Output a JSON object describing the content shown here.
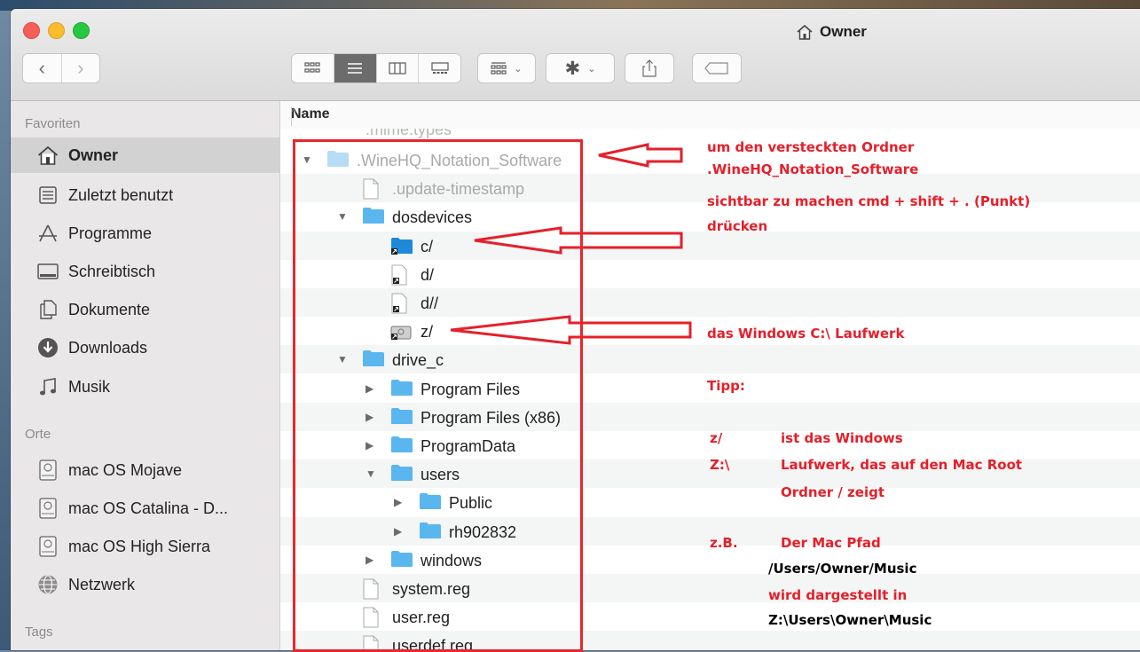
{
  "window": {
    "title": "Owner"
  },
  "toolbar": {
    "back_label": "‹",
    "forward_label": "›",
    "views": [
      "icon-view",
      "list-view",
      "column-view",
      "gallery-view"
    ],
    "group_by": "group-by",
    "action": "gear",
    "share": "share",
    "tags": "tag"
  },
  "sidebar": {
    "favorites_header": "Favoriten",
    "favorites": [
      {
        "label": "Owner",
        "icon": "home-icon",
        "selected": true
      },
      {
        "label": "Zuletzt benutzt",
        "icon": "recents-icon"
      },
      {
        "label": "Programme",
        "icon": "applications-icon"
      },
      {
        "label": "Schreibtisch",
        "icon": "desktop-icon"
      },
      {
        "label": "Dokumente",
        "icon": "documents-icon"
      },
      {
        "label": "Downloads",
        "icon": "downloads-icon"
      },
      {
        "label": "Musik",
        "icon": "music-icon"
      }
    ],
    "locations_header": "Orte",
    "locations": [
      {
        "label": "mac OS Mojave",
        "icon": "disk-icon"
      },
      {
        "label": "mac OS Catalina - D...",
        "icon": "disk-icon"
      },
      {
        "label": "mac OS High Sierra",
        "icon": "disk-icon"
      },
      {
        "label": "Netzwerk",
        "icon": "network-icon"
      }
    ],
    "tags_header": "Tags"
  },
  "list": {
    "column_name": "Name",
    "partial_item": ".mime.types",
    "rows": [
      {
        "name": ".WineHQ_Notation_Software",
        "kind": "folder",
        "depth": 0,
        "expanded": true,
        "hidden": true
      },
      {
        "name": ".update-timestamp",
        "kind": "file",
        "depth": 1,
        "hidden": true
      },
      {
        "name": "dosdevices",
        "kind": "folder",
        "depth": 1,
        "expanded": true
      },
      {
        "name": "c/",
        "kind": "alias-folder",
        "depth": 2
      },
      {
        "name": "d/",
        "kind": "alias",
        "depth": 2
      },
      {
        "name": "d//",
        "kind": "alias",
        "depth": 2
      },
      {
        "name": "z/",
        "kind": "alias-disk",
        "depth": 2
      },
      {
        "name": "drive_c",
        "kind": "folder",
        "depth": 1,
        "expanded": true
      },
      {
        "name": "Program Files",
        "kind": "folder",
        "depth": 2,
        "expanded": false
      },
      {
        "name": "Program Files (x86)",
        "kind": "folder",
        "depth": 2,
        "expanded": false
      },
      {
        "name": "ProgramData",
        "kind": "folder",
        "depth": 2,
        "expanded": false
      },
      {
        "name": "users",
        "kind": "folder",
        "depth": 2,
        "expanded": true
      },
      {
        "name": "Public",
        "kind": "folder",
        "depth": 3,
        "expanded": false
      },
      {
        "name": "rh902832",
        "kind": "folder",
        "depth": 3,
        "expanded": false
      },
      {
        "name": "windows",
        "kind": "folder",
        "depth": 2,
        "expanded": false
      },
      {
        "name": "system.reg",
        "kind": "file",
        "depth": 1
      },
      {
        "name": "user.reg",
        "kind": "file",
        "depth": 1
      },
      {
        "name": "userdef.reg",
        "kind": "file",
        "depth": 1
      }
    ]
  },
  "annotations": {
    "note1_line1": "um den versteckten Ordner",
    "note1_line2": ".WineHQ_Notation_Software",
    "note1_line3": "sichtbar zu machen cmd + shift + . (Punkt)",
    "note1_line4": "drücken",
    "note2": "das Windows C:\\ Laufwerk",
    "tip_title": "Tipp:",
    "tip_z1": "z/",
    "tip_z2": "Z:\\",
    "tip_text1": "ist das Windows",
    "tip_text2": "Laufwerk, das auf den Mac Root",
    "tip_text3": "Ordner / zeigt",
    "zb": "z.B.",
    "zb_line1": "Der Mac Pfad",
    "zb_line2": "/Users/Owner/Music",
    "zb_line3": "wird dargestellt in",
    "zb_line4": "Z:\\Users\\Owner\\Music"
  },
  "colors": {
    "annotation_red": "#e4202a",
    "folder_blue": "#5ab6ee",
    "selection_gray": "#d3d2d2"
  }
}
